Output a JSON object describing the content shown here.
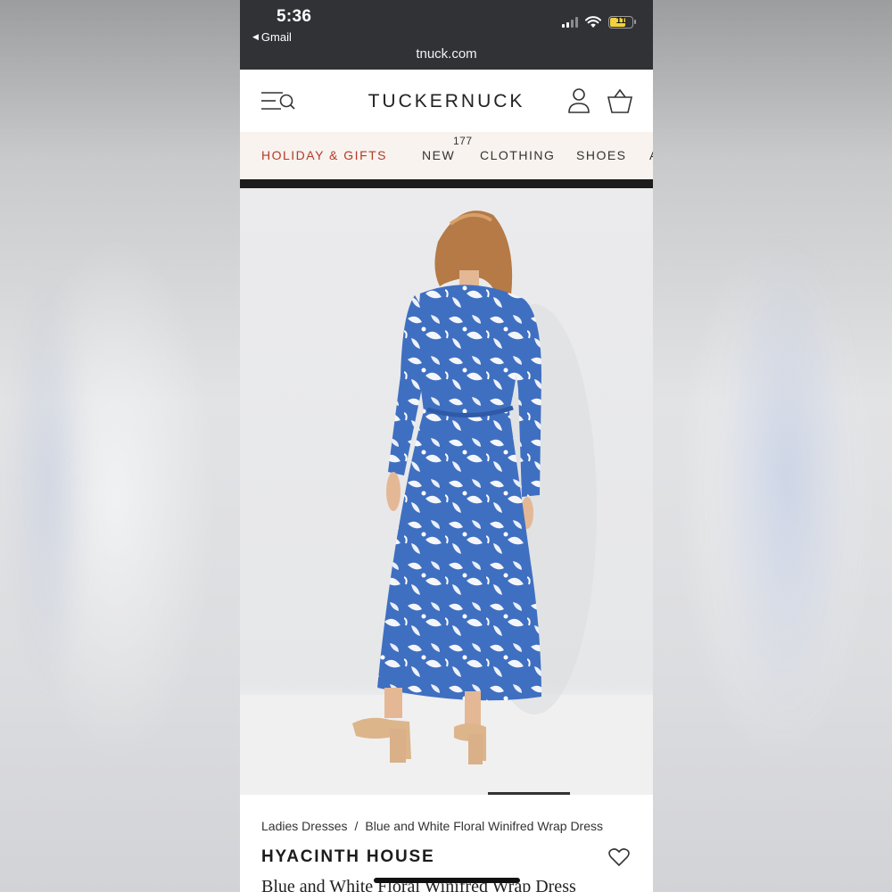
{
  "status_bar": {
    "time": "5:36",
    "back_app": "Gmail",
    "battery": "11",
    "url": "tnuck.com",
    "colors": {
      "background": "#303236",
      "battery": "#f1d23c"
    }
  },
  "header": {
    "brand": "TUCKERNUCK",
    "icons": [
      "menu-search-icon",
      "account-icon",
      "bag-icon"
    ]
  },
  "nav": {
    "items": [
      {
        "label": "HOLIDAY & GIFTS",
        "color": "#b33a2a"
      },
      {
        "label": "NEW"
      },
      {
        "label": "CLOTHING"
      },
      {
        "label": "SHOES"
      },
      {
        "label": "A"
      }
    ],
    "badge": "177",
    "background": "#f8f3ee"
  },
  "product": {
    "image_alt": "Model wearing blue and white floral long-sleeve wrap maxi dress, back view",
    "breadcrumb": [
      "Ladies Dresses",
      "/",
      "Blue and White Floral Winifred Wrap Dress"
    ],
    "brand": "HYACINTH HOUSE",
    "title": "Blue and White Floral Winifred Wrap Dress",
    "dress_color": "#3f6fc0"
  }
}
